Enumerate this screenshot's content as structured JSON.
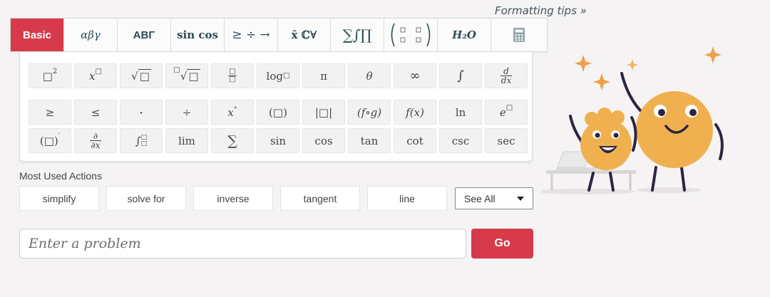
{
  "formatting_tips": "Formatting tips »",
  "tabs": [
    {
      "label": "Basic",
      "active": true
    },
    {
      "label": "αβγ"
    },
    {
      "label": "ΑΒΓ"
    },
    {
      "label": "sin cos"
    },
    {
      "label": "≥ ÷ →"
    },
    {
      "label": "x̄ ℂ∀"
    },
    {
      "label": "∑∫∏"
    },
    {
      "label": "( ▫ ▫ )"
    },
    {
      "label": "H₂O"
    },
    {
      "label": "calculator",
      "icon": "calculator-icon"
    }
  ],
  "keypad": {
    "row1": [
      "□²",
      "x□",
      "√□",
      "□√□",
      "□/□",
      "log□",
      "π",
      "θ",
      "∞",
      "∫",
      "d/dx"
    ],
    "row2": [
      "≥",
      "≤",
      "·",
      "÷",
      "x°",
      "(□)",
      "|□|",
      "(f∘g)",
      "f(x)",
      "ln",
      "e□"
    ],
    "row3": [
      "(□)′",
      "∂/∂x",
      "∫□□",
      "lim",
      "∑",
      "sin",
      "cos",
      "tan",
      "cot",
      "csc",
      "sec"
    ]
  },
  "most_used": {
    "title": "Most Used Actions",
    "actions": [
      "simplify",
      "solve for",
      "inverse",
      "tangent",
      "line"
    ],
    "see_all": "See All"
  },
  "problem_input": {
    "placeholder": "Enter a problem",
    "value": ""
  },
  "go_label": "Go",
  "colors": {
    "accent": "#d63a4b",
    "mascot": "#f0b04f",
    "sparkle": "#f0a04b"
  }
}
